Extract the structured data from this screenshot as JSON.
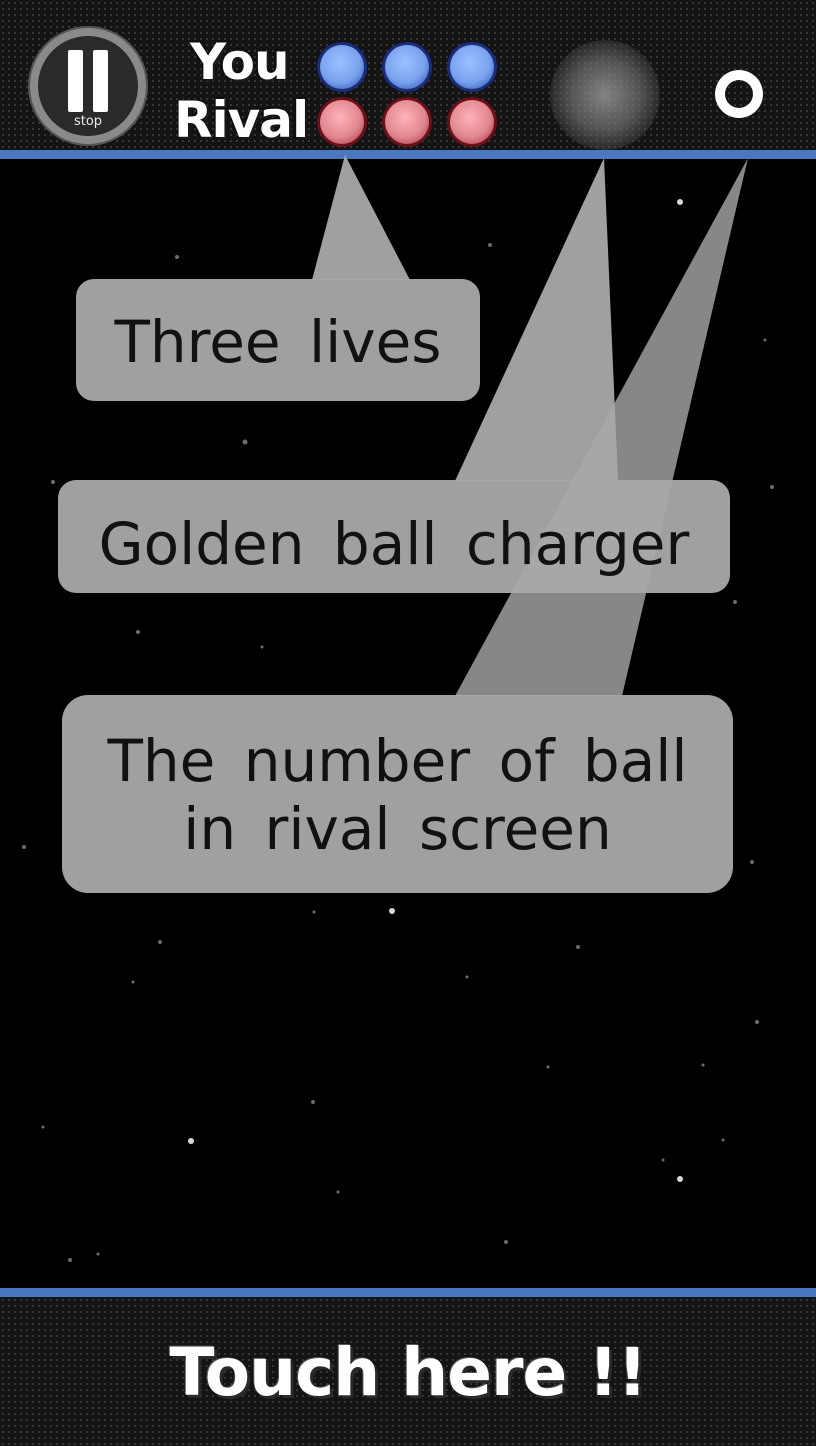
{
  "hud": {
    "pause_label": "stop",
    "you_label": "You",
    "rival_label": "Rival",
    "you_lives": 3,
    "rival_lives": 3,
    "you_life_color": "#7aa2ee",
    "rival_life_color": "#e08890",
    "charger_icon": "golden-ball-charger",
    "rival_ball_indicator_icon": "ring"
  },
  "tutorial": {
    "callout_lives": "Three lives",
    "callout_charger": "Golden ball charger",
    "callout_rival_balls_line1": "The number of ball",
    "callout_rival_balls_line2": "in rival screen"
  },
  "footer": {
    "touch_prompt": "Touch here !!"
  },
  "colors": {
    "accent_line": "#4a78c0",
    "bubble_fill": "#a9a9a9",
    "background": "#000000"
  }
}
